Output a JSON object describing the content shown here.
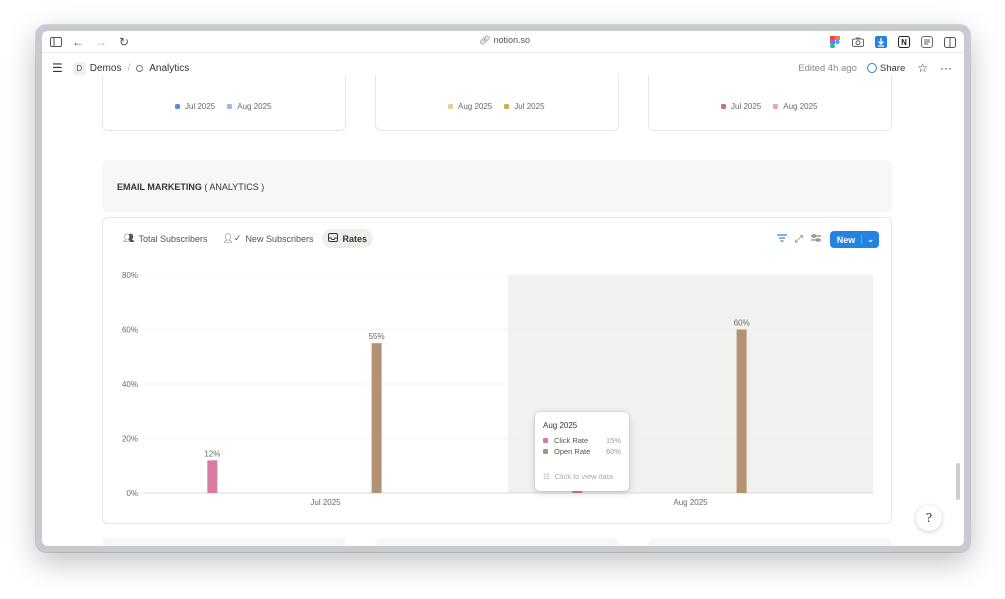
{
  "browser": {
    "url": "notion.so"
  },
  "header": {
    "workspace_initial": "D",
    "breadcrumb_parent": "Demos",
    "breadcrumb_current": "Analytics",
    "edited": "Edited 4h ago",
    "share_label": "Share"
  },
  "top_cards": [
    {
      "legend": [
        {
          "label": "Jul 2025",
          "color": "#5a8fd6"
        },
        {
          "label": "Aug 2025",
          "color": "#9bbbe6"
        }
      ]
    },
    {
      "legend": [
        {
          "label": "Aug 2025",
          "color": "#e6cf8f"
        },
        {
          "label": "Jul 2025",
          "color": "#cfae4f"
        }
      ]
    },
    {
      "legend": [
        {
          "label": "Jul 2025",
          "color": "#c86b96"
        },
        {
          "label": "Aug 2025",
          "color": "#e3a6c0"
        }
      ]
    }
  ],
  "section": {
    "title_bold": "EMAIL MARKETING",
    "title_rest": " ( ANALYTICS )"
  },
  "tabs": [
    {
      "label": "Total Subscribers",
      "icon": "people-icon"
    },
    {
      "label": "New Subscribers",
      "icon": "person-check-icon"
    },
    {
      "label": "Rates",
      "icon": "inbox-icon"
    }
  ],
  "toolbar": {
    "new_label": "New"
  },
  "chart_data": {
    "type": "bar",
    "categories": [
      "Jul 2025",
      "Aug 2025"
    ],
    "series": [
      {
        "name": "Click Rate",
        "values": [
          12,
          15
        ],
        "color": "#d77ba3"
      },
      {
        "name": "Open Rate",
        "values": [
          55,
          60
        ],
        "color": "#b39274"
      }
    ],
    "ylim": [
      0,
      80
    ],
    "yticks": [
      "0%",
      "20%",
      "40%",
      "60%",
      "80%"
    ],
    "ytick_values": [
      0,
      20,
      40,
      60,
      80
    ],
    "data_labels": [
      [
        "12%",
        "15%"
      ],
      [
        "55%",
        "60%"
      ]
    ],
    "highlighted_category": "Aug 2025",
    "grid": true
  },
  "tooltip": {
    "title": "Aug 2025",
    "rows": [
      {
        "label": "Click Rate",
        "value": "15%",
        "color": "#d77ba3"
      },
      {
        "label": "Open Rate",
        "value": "60%",
        "color": "#b39274"
      }
    ],
    "hint": "Click to view data"
  }
}
